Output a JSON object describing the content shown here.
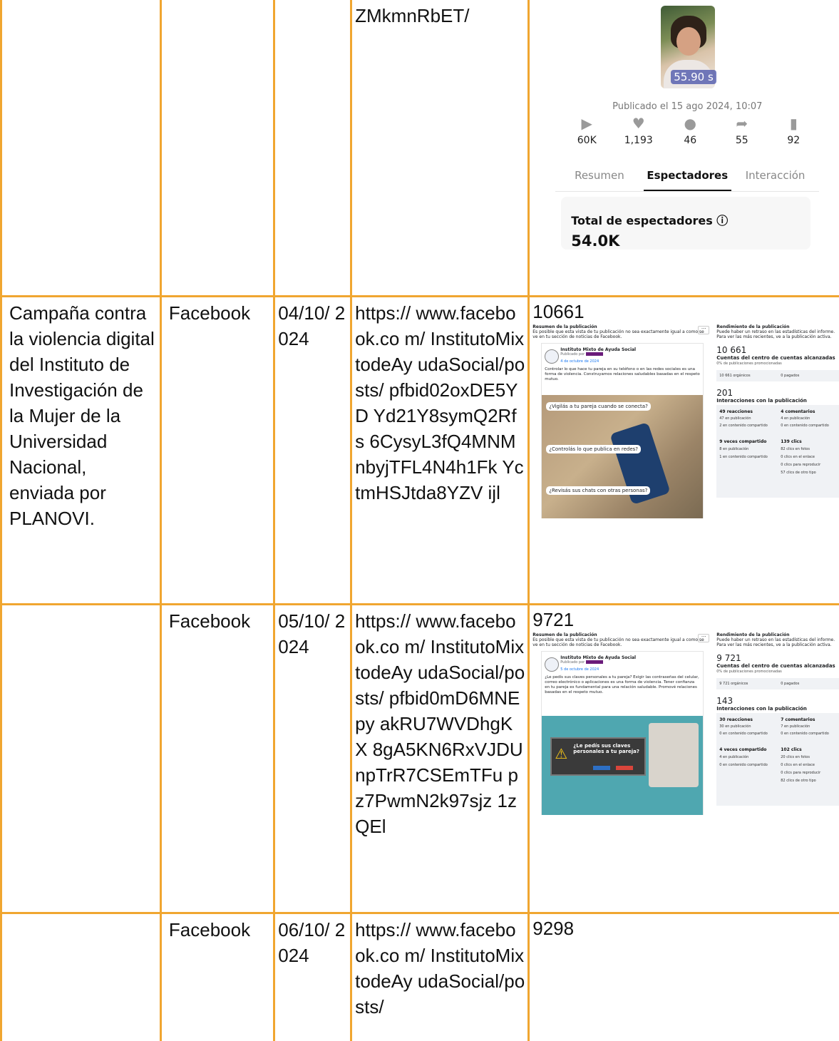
{
  "row0": {
    "url_tail": "ZMkmnRbET/",
    "tiktok": {
      "duration": "55.90 s",
      "published": "Publicado el 15 ago 2024, 10:07",
      "stats": [
        {
          "icon": "play-icon",
          "value": "60K"
        },
        {
          "icon": "heart-icon",
          "value": "1,193"
        },
        {
          "icon": "comment-icon",
          "value": "46"
        },
        {
          "icon": "share-icon",
          "value": "55"
        },
        {
          "icon": "bookmark-icon",
          "value": "92"
        }
      ],
      "tabs": [
        "Resumen",
        "Espectadores",
        "Interacción"
      ],
      "active_tab": "Espectadores",
      "total_label": "Total de espectadores ⓘ",
      "total_value": "54.0K"
    }
  },
  "row1": {
    "campaign": "Campaña contra la violencia digital del Instituto de Investigación de la Mujer de la Universidad Nacional, enviada por PLANOVI.",
    "platform": "Facebook",
    "date": "04/10/ 2024",
    "url": "https:// www.facebook.co m/ InstitutoMixtodeAy udaSocial/posts/ pfbid02oxDE5YD Yd21Y8symQ2Rfs 6CysyL3fQ4MNM nbyjTFL4N4h1Fk YctmHSJtda8YZV ijl",
    "reach": "10661",
    "shot": {
      "left_title": "Resumen de la publicación",
      "left_note": "Es posible que esta vista de tu publicación no sea exactamente igual a como se ve en tu sección de noticias de Facebook.",
      "page_name": "Instituto Mixto de Ayuda Social",
      "published_by": "Publicado por",
      "post_date": "4 de octubre de 2024",
      "post_text": "Controlar lo que hace tu pareja en su teléfono o en las redes sociales es una forma de violencia. Construyamos relaciones saludables basadas en el respeto mutuo.",
      "bubbles": [
        "¿Vigilás a tu pareja cuando se conecta?",
        "¿Controlás lo que publica en redes?",
        "¿Revisás sus chats con otras personas?"
      ],
      "right_title": "Rendimiento de la publicación",
      "right_note": "Puede haber un retraso en las estadísticas del informe. Para ver las más recientes, ve a la publicación activa.",
      "reach_big": "10 661",
      "reach_label": "Cuentas del centro de cuentas alcanzadas",
      "promo": "0% de publicaciones promocionadas",
      "organic": "10 661 orgánicos",
      "paid": "0 pagados",
      "interactions_big": "201",
      "interactions_label": "Interacciones con la publicación",
      "grid": [
        [
          "49 reacciones",
          "4 comentarios"
        ],
        [
          "47 en publicación",
          "4 en publicación"
        ],
        [
          "2 en contenido compartido",
          "0 en contenido compartido"
        ],
        [
          "9 veces compartido",
          "139 clics"
        ],
        [
          "8 en publicación",
          "82 clics en fotos"
        ],
        [
          "1 en contenido compartido",
          "0 clics en el enlace"
        ],
        [
          "",
          "0 clics para reproducir"
        ],
        [
          "",
          "57 clics de otro tipo"
        ]
      ]
    }
  },
  "row2": {
    "platform": "Facebook",
    "date": "05/10/ 2024",
    "url": "https:// www.facebook.co m/ InstitutoMixtodeAy udaSocial/posts/ pfbid0mD6MNEpy akRU7WVDhgKX 8gA5KN6RxVJDU npTrR7CSEmTFu pz7PwmN2k97sjz 1zQEl",
    "reach": "9721",
    "shot": {
      "left_title": "Resumen de la publicación",
      "left_note": "Es posible que esta vista de tu publicación no sea exactamente igual a como se ve en tu sección de noticias de Facebook.",
      "page_name": "Instituto Mixto de Ayuda Social",
      "published_by": "Publicado por",
      "post_date": "5 de octubre de 2024",
      "post_text": "¿Le pedís sus claves personales a tu pareja? Exigir las contraseñas del celular, correo electrónico o aplicaciones es una forma de violencia. Tener confianza en tu pareja es fundamental para una relación saludable. Promové relaciones basadas en el respeto mutuo.",
      "dialog_text": "¿Le pedís sus claves personales a tu pareja?",
      "right_title": "Rendimiento de la publicación",
      "right_note": "Puede haber un retraso en las estadísticas del informe. Para ver las más recientes, ve a la publicación activa.",
      "reach_big": "9 721",
      "reach_label": "Cuentas del centro de cuentas alcanzadas",
      "promo": "0% de publicaciones promocionadas",
      "organic": "9 721 orgánicos",
      "paid": "0 pagados",
      "interactions_big": "143",
      "interactions_label": "Interacciones con la publicación",
      "grid": [
        [
          "30 reacciones",
          "7 comentarios"
        ],
        [
          "30 en publicación",
          "7 en publicación"
        ],
        [
          "0 en contenido compartido",
          "0 en contenido compartido"
        ],
        [
          "4 veces compartido",
          "102 clics"
        ],
        [
          "4 en publicación",
          "20 clics en fotos"
        ],
        [
          "0 en contenido compartido",
          "0 clics en el enlace"
        ],
        [
          "",
          "0 clics para reproducir"
        ],
        [
          "",
          "82 clics de otro tipo"
        ]
      ]
    }
  },
  "row3": {
    "platform": "Facebook",
    "date": "06/10/ 2024",
    "url": "https:// www.facebook.co m/ InstitutoMixtodeAy udaSocial/posts/",
    "reach": "9298"
  }
}
